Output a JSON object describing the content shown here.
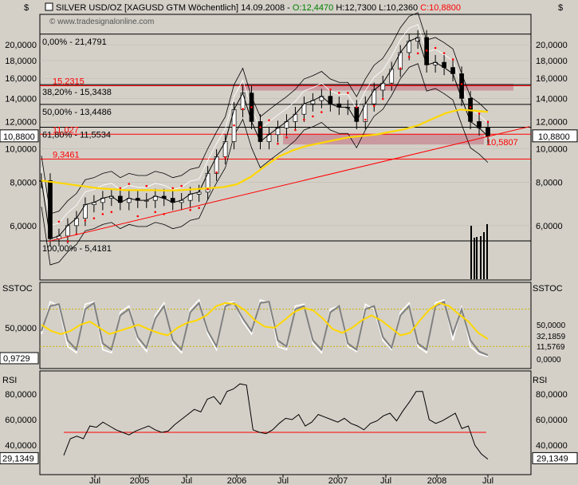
{
  "header": {
    "title": "SILVER USD/OZ [XAGUSD GTM  Wöchentlich] 14.09.2008 -",
    "open": "O:12,4470",
    "high": "H:12,7300",
    "low": "L:10,2360",
    "close": "C:10,8800",
    "watermark": "© www.tradesignalonline.com",
    "currency_label": "$",
    "colors": {
      "open": "#008000",
      "close": "#ff0000",
      "text": "#000000"
    }
  },
  "price_panel": {
    "fib_labels": [
      {
        "text": "0,00% - 21,4791",
        "value": 21.4791
      },
      {
        "text": "38,20% - 15,3438",
        "value": 15.3438
      },
      {
        "text": "50,00% - 13,4486",
        "value": 13.4486
      },
      {
        "text": "61,80% - 11,5534",
        "value": 11.5534
      },
      {
        "text": "100,00% - 5,4181",
        "value": 5.4181
      }
    ],
    "red_labels": [
      {
        "text": "15,2315",
        "value": 15.2315
      },
      {
        "text": "11,027",
        "value": 11.027
      },
      {
        "text": "9,3461",
        "value": 9.3461
      },
      {
        "text": "10,5807",
        "value": 10.5807
      }
    ],
    "last_value_left": "10,8800",
    "last_value_right": "10,8800",
    "colors": {
      "bg": "#d4d0c8",
      "fib_line": "#000000",
      "red_line": "#ff0000",
      "zone": "#c9929a",
      "ma": "#ffd700",
      "psar": "#ff0000",
      "bollinger": "#000000",
      "envelope": "#ffffff"
    }
  },
  "sstoc_panel": {
    "label_left": "SSTOC",
    "label_right": "SSTOC",
    "last_value_left": "0,9729",
    "values_right": [
      "50,0000",
      "32,1859",
      "11,5769",
      "0,0000"
    ],
    "colors": {
      "k": "#ffffff",
      "d": "#808080",
      "signal": "#ffd700",
      "band": "#c8b400"
    }
  },
  "rsi_panel": {
    "label_left": "RSI",
    "label_right": "RSI",
    "last_value_left": "29,1349",
    "last_value_right": "29,1349",
    "colors": {
      "line": "#000000",
      "level": "#ff0000"
    }
  },
  "chart_data": [
    {
      "type": "line",
      "title": "SILVER USD/OZ [XAGUSD GTM  Wöchentlich]",
      "scale": "log",
      "yticks_left": [
        "20,0000",
        "18,0000",
        "16,0000",
        "14,0000",
        "12,0000",
        "10,0000",
        "8,0000",
        "6,0000"
      ],
      "yticks_right": [
        "20,0000",
        "18,0000",
        "16,0000",
        "14,0000",
        "12,0000",
        "10,0000",
        "8,0000",
        "6,0000"
      ],
      "ytick_values": [
        20,
        18,
        16,
        14,
        12,
        10,
        8,
        6
      ],
      "xticks": [
        "Jul",
        "2005",
        "Jul",
        "2006",
        "Jul",
        "2007",
        "Jul",
        "2008",
        "Jul"
      ],
      "ylim": [
        4.2,
        24.5
      ],
      "series": [
        {
          "values": [
            8.1,
            5.5,
            5.6,
            6.0,
            6.3,
            6.9,
            7.0,
            7.2,
            7.3,
            7.0,
            7.2,
            7.1,
            7.1,
            7.3,
            7.2,
            7.0,
            7.1,
            7.4,
            7.5,
            8.5,
            9.5,
            10.5,
            13.0,
            14.5,
            12.0,
            10.5,
            11.0,
            11.5,
            12.0,
            12.6,
            13.5,
            13.8,
            14.2,
            13.5,
            13.2,
            13.2,
            12.0,
            13.5,
            14.8,
            15.5,
            17.0,
            19.0,
            20.5,
            21.0,
            17.5,
            17.8,
            17.2,
            16.5,
            14.0,
            12.0,
            11.5,
            10.88
          ]
        },
        {
          "values": [
            8.1,
            8.0,
            7.9,
            7.8,
            7.7,
            7.65,
            7.6,
            7.6,
            7.6,
            7.58,
            7.6,
            7.65,
            7.7,
            7.75,
            7.9,
            8.3,
            8.9,
            9.5,
            9.9,
            10.2,
            10.4,
            10.6,
            10.8,
            10.9,
            11.0,
            11.2,
            11.4,
            11.7,
            12.2,
            12.7,
            13.0,
            12.9,
            12.8
          ]
        }
      ]
    },
    {
      "type": "line",
      "title": "SSTOC",
      "ylim": [
        0,
        100
      ],
      "yticks": [
        "50,0000"
      ],
      "series": [
        {
          "values": [
            40,
            92,
            85,
            20,
            10,
            88,
            92,
            15,
            10,
            75,
            85,
            30,
            12,
            70,
            90,
            25,
            10,
            80,
            95,
            40,
            15,
            90,
            92,
            60,
            40,
            95,
            90,
            20,
            15,
            85,
            88,
            25,
            10,
            80,
            85,
            20,
            12,
            88,
            80,
            30,
            15,
            75,
            90,
            20,
            10,
            90,
            95,
            30,
            85,
            20,
            8,
            4
          ]
        },
        {
          "values": [
            45,
            85,
            88,
            30,
            15,
            80,
            90,
            25,
            15,
            70,
            80,
            35,
            18,
            65,
            85,
            30,
            15,
            75,
            90,
            45,
            20,
            85,
            90,
            65,
            45,
            90,
            92,
            30,
            20,
            80,
            85,
            30,
            15,
            75,
            85,
            25,
            15,
            80,
            85,
            35,
            18,
            70,
            85,
            25,
            15,
            85,
            92,
            40,
            80,
            30,
            12,
            6
          ]
        },
        {
          "values": [
            55,
            45,
            40,
            45,
            55,
            60,
            50,
            40,
            45,
            50,
            55,
            48,
            42,
            38,
            50,
            58,
            62,
            70,
            85,
            90,
            88,
            78,
            62,
            52,
            50,
            62,
            75,
            82,
            78,
            65,
            48,
            42,
            50,
            62,
            70,
            62,
            50,
            38,
            42,
            62,
            80,
            90,
            85,
            72,
            60,
            42,
            32
          ]
        }
      ]
    },
    {
      "type": "line",
      "title": "RSI",
      "ylim": [
        20,
        95
      ],
      "yticks": [
        "80,0000",
        "60,0000",
        "40,0000"
      ],
      "series": [
        {
          "values": [
            32,
            45,
            47,
            45,
            55,
            54,
            58,
            55,
            52,
            50,
            48,
            51,
            53,
            55,
            52,
            50,
            51,
            56,
            60,
            64,
            68,
            66,
            76,
            78,
            72,
            82,
            84,
            88,
            87,
            52,
            50,
            49,
            52,
            57,
            61,
            60,
            64,
            55,
            58,
            64,
            62,
            60,
            58,
            61,
            57,
            55,
            52,
            57,
            59,
            63,
            65,
            59,
            67,
            74,
            82,
            82,
            60,
            57,
            59,
            62,
            65,
            53,
            55,
            40,
            33,
            29
          ]
        },
        {
          "values": [
            50,
            50
          ]
        }
      ]
    }
  ]
}
